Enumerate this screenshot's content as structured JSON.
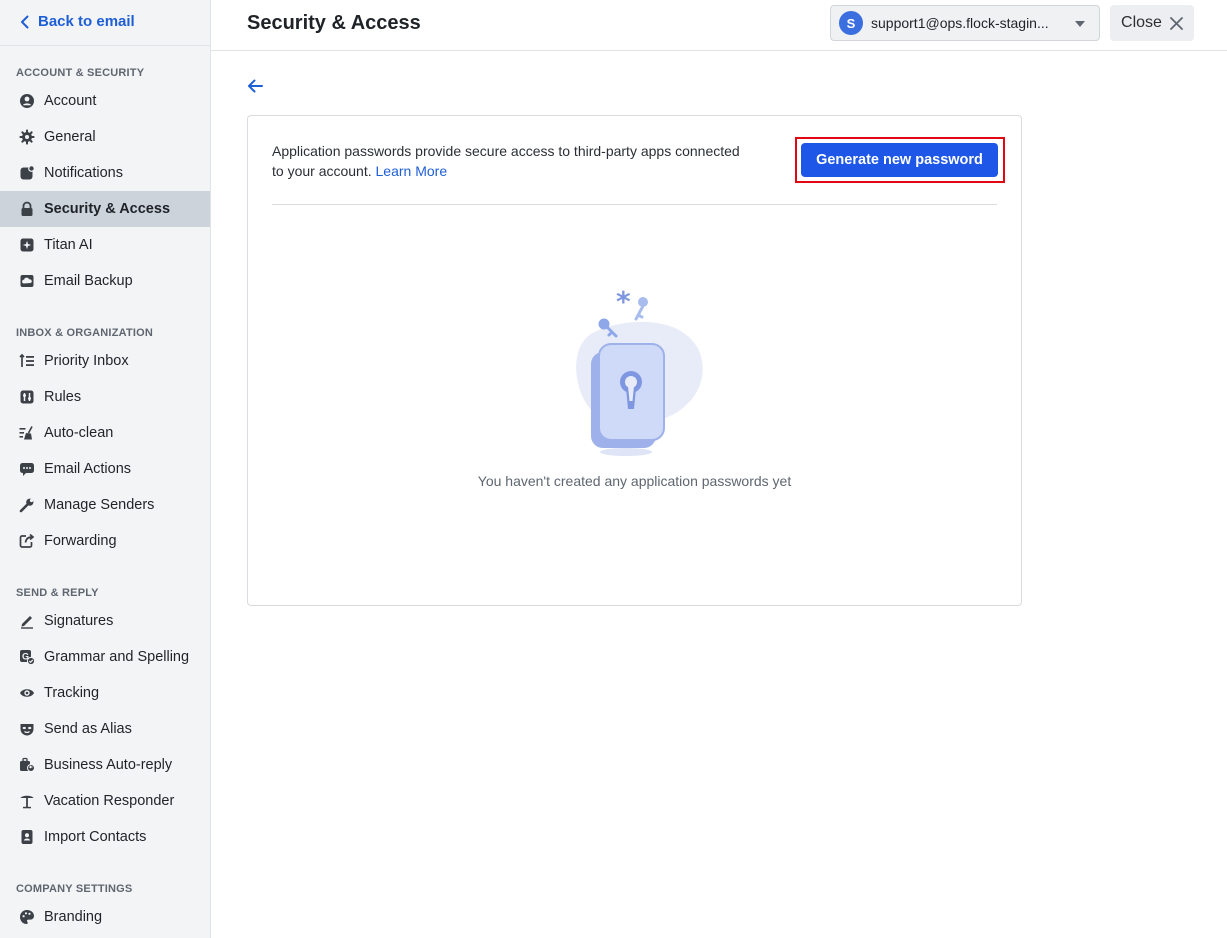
{
  "sidebar": {
    "back_label": "Back to email",
    "sections": [
      {
        "title": "ACCOUNT & SECURITY",
        "items": [
          {
            "label": "Account",
            "icon": "user-circle-icon"
          },
          {
            "label": "General",
            "icon": "gear-icon"
          },
          {
            "label": "Notifications",
            "icon": "notification-icon"
          },
          {
            "label": "Security & Access",
            "icon": "lock-icon",
            "active": true
          },
          {
            "label": "Titan AI",
            "icon": "sparkle-icon"
          },
          {
            "label": "Email Backup",
            "icon": "cloud-backup-icon"
          }
        ]
      },
      {
        "title": "INBOX & ORGANIZATION",
        "items": [
          {
            "label": "Priority Inbox",
            "icon": "priority-list-icon"
          },
          {
            "label": "Rules",
            "icon": "rules-icon"
          },
          {
            "label": "Auto-clean",
            "icon": "broom-icon"
          },
          {
            "label": "Email Actions",
            "icon": "chat-dots-icon"
          },
          {
            "label": "Manage Senders",
            "icon": "wrench-icon"
          },
          {
            "label": "Forwarding",
            "icon": "forward-icon"
          }
        ]
      },
      {
        "title": "SEND & REPLY",
        "items": [
          {
            "label": "Signatures",
            "icon": "pen-icon"
          },
          {
            "label": "Grammar and Spelling",
            "icon": "grammar-icon"
          },
          {
            "label": "Tracking",
            "icon": "eye-icon"
          },
          {
            "label": "Send as Alias",
            "icon": "mask-icon"
          },
          {
            "label": "Business Auto-reply",
            "icon": "auto-reply-icon"
          },
          {
            "label": "Vacation Responder",
            "icon": "palm-tree-icon"
          },
          {
            "label": "Import Contacts",
            "icon": "contact-book-icon"
          }
        ]
      },
      {
        "title": "COMPANY SETTINGS",
        "items": [
          {
            "label": "Branding",
            "icon": "palette-icon"
          }
        ]
      }
    ]
  },
  "header": {
    "title": "Security & Access",
    "account_initial": "S",
    "account_email": "support1@ops.flock-stagin...",
    "close_label": "Close"
  },
  "main": {
    "description": "Application passwords provide secure access to third-party apps connected to your account.",
    "learn_more": "Learn More",
    "generate_button": "Generate new password",
    "empty_state": "You haven't created any application passwords yet"
  },
  "colors": {
    "accent": "#1e56e8",
    "link": "#1f5fd6",
    "highlight": "#e30613",
    "sidebar_bg": "#f3f4f6",
    "active_item_bg": "#cdd3db"
  }
}
